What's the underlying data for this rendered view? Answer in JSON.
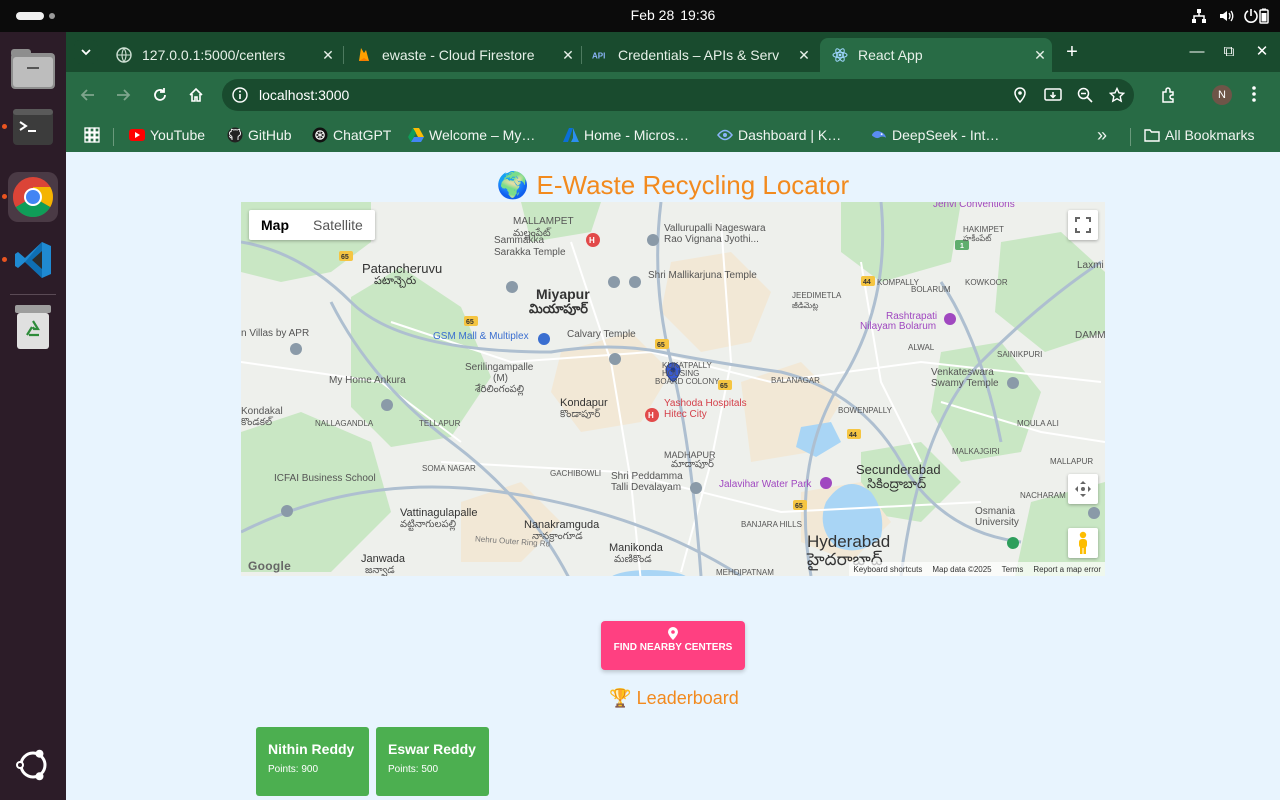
{
  "system": {
    "date": "Feb 28",
    "time": "19:36"
  },
  "browser": {
    "tabs": [
      {
        "title": "127.0.0.1:5000/centers",
        "icon": "globe-icon"
      },
      {
        "title": "ewaste - Cloud Firestore",
        "icon": "firebase-icon"
      },
      {
        "title": "Credentials – APIs & Serv",
        "icon": "api-icon"
      },
      {
        "title": "React App",
        "icon": "react-icon",
        "active": true
      }
    ],
    "url": "localhost:3000",
    "profile_initial": "N",
    "bookmarks": [
      {
        "label": "YouTube",
        "icon": "youtube-icon"
      },
      {
        "label": "GitHub",
        "icon": "github-icon"
      },
      {
        "label": "ChatGPT",
        "icon": "chatgpt-icon"
      },
      {
        "label": "Welcome – My…",
        "icon": "google-drive-icon"
      },
      {
        "label": "Home - Micros…",
        "icon": "azure-icon"
      },
      {
        "label": "Dashboard | K…",
        "icon": "kaggle-icon"
      },
      {
        "label": "DeepSeek - Int…",
        "icon": "deepseek-icon"
      }
    ],
    "all_bookmarks_label": "All Bookmarks"
  },
  "page": {
    "title_emoji": "🌍",
    "title": "E-Waste Recycling Locator",
    "map": {
      "type_map": "Map",
      "type_satellite": "Satellite",
      "attribution": {
        "shortcuts": "Keyboard shortcuts",
        "data": "Map data ©2025",
        "terms": "Terms",
        "report": "Report a map error"
      },
      "google_logo": "Google",
      "labels": {
        "mallampet": "MALLAMPET",
        "mallampet_te": "మల్లంపేట్",
        "jenvi": "Jenvi Conventions",
        "hakimpet": "HAKIMPET",
        "hakimpet_te": "హకీంపేట్",
        "vallurupalli": "Vallurupalli Nageswara",
        "rao": "Rao Vignana Jyothi...",
        "sammakka": "Sammakka",
        "sarakka": "Sarakka Temple",
        "patancheruvu": "Patancheruvu",
        "patancheruvu_te": "పటాన్చెరు",
        "miyapur": "Miyapur",
        "miyapur_te": "మియాపూర్",
        "shri_mallik": "Shri Mallikarjuna Temple",
        "kompally": "KOMPALLY",
        "kowkoor": "KOWKOOR",
        "laxmi": "Laxmi",
        "jeedimetla": "JEEDIMETLA",
        "jeedimetla_te": "జీడిమెట్ల",
        "bolarum": "BOLARUM",
        "rashtrapati": "Rashtrapati",
        "nilayam": "Nilayam Bolarum",
        "damm": "DAMM",
        "gsm": "GSM Mall & Multiplex",
        "calvary": "Calvary Temple",
        "alwal": "ALWAL",
        "sainikpuri": "SAINIKPURI",
        "villas": "n Villas by APR",
        "serilingampalle": "Serilingampalle",
        "m": "(M)",
        "serilingampalle_te": "శేరిలింగంపల్లి",
        "kukatpally": "KUKATPALLY",
        "housing": "HOUSING",
        "board": "BOARD COLONY",
        "balanagar": "BALANAGAR",
        "venkateswara": "Venkateswara",
        "swamy": "Swamy Temple",
        "myhome": "My Home Ankura",
        "kondapur": "Kondapur",
        "kondapur_te": "కొండాపూర్",
        "yashoda": "Yashoda Hospitals",
        "hitec": "Hitec City",
        "kondakal": "Kondakal",
        "kondakal_te": "కొండకల్",
        "nallagandla": "NALLAGANDLA",
        "tellapur": "TELLAPUR",
        "bowenpally": "BOWENPALLY",
        "moula": "MOULA ALI",
        "madhapur": "MADHAPUR",
        "madhapur_te": "మాదాపూర్",
        "malkajgiri": "MALKAJGIRI",
        "mallapur": "MALLAPUR",
        "icfai": "ICFAI Business School",
        "somnagar": "SOMA NAGAR",
        "gachibowli": "GACHIBOWLI",
        "shripeddamma": "Shri Peddamma",
        "talli": "Talli Devalayam",
        "jalavihar": "Jalavihar Water Park",
        "secunderabad": "Secunderabad",
        "secunderabad_te": "సికింద్రాబాద్",
        "nacharam": "NACHARAM",
        "osmania": "Osmania",
        "university": "University",
        "vattinagulapalle": "Vattinagulapalle",
        "vattinagulapalle_te": "వట్టినాగులపల్లి",
        "nanakramguda": "Nanakramguda",
        "nanakramguda_te": "నానక్రాంగూడ",
        "banjara": "BANJARA HILLS",
        "hyderabad": "Hyderabad",
        "hyderabad_te": "హైదరాబాద్",
        "janwada": "Janwada",
        "janwada_te": "జన్వాడ",
        "manikonda": "Manikonda",
        "manikonda_te": "మణికొండ",
        "mehdipatnam": "MEHDIPATNAM",
        "nehru": "Nehru Outer Ring Rd"
      }
    },
    "find_button": "FIND NEARBY CENTERS",
    "leaderboard_emoji": "🏆",
    "leaderboard_title": "Leaderboard",
    "leaders": [
      {
        "name": "Nithin Reddy",
        "points": "Points: 900"
      },
      {
        "name": "Eswar Reddy",
        "points": "Points: 500"
      }
    ]
  },
  "colors": {
    "title_orange": "#f28a1e",
    "button_pink": "#ff4081",
    "card_green": "#4caf50",
    "browser_frame": "#286b45"
  }
}
